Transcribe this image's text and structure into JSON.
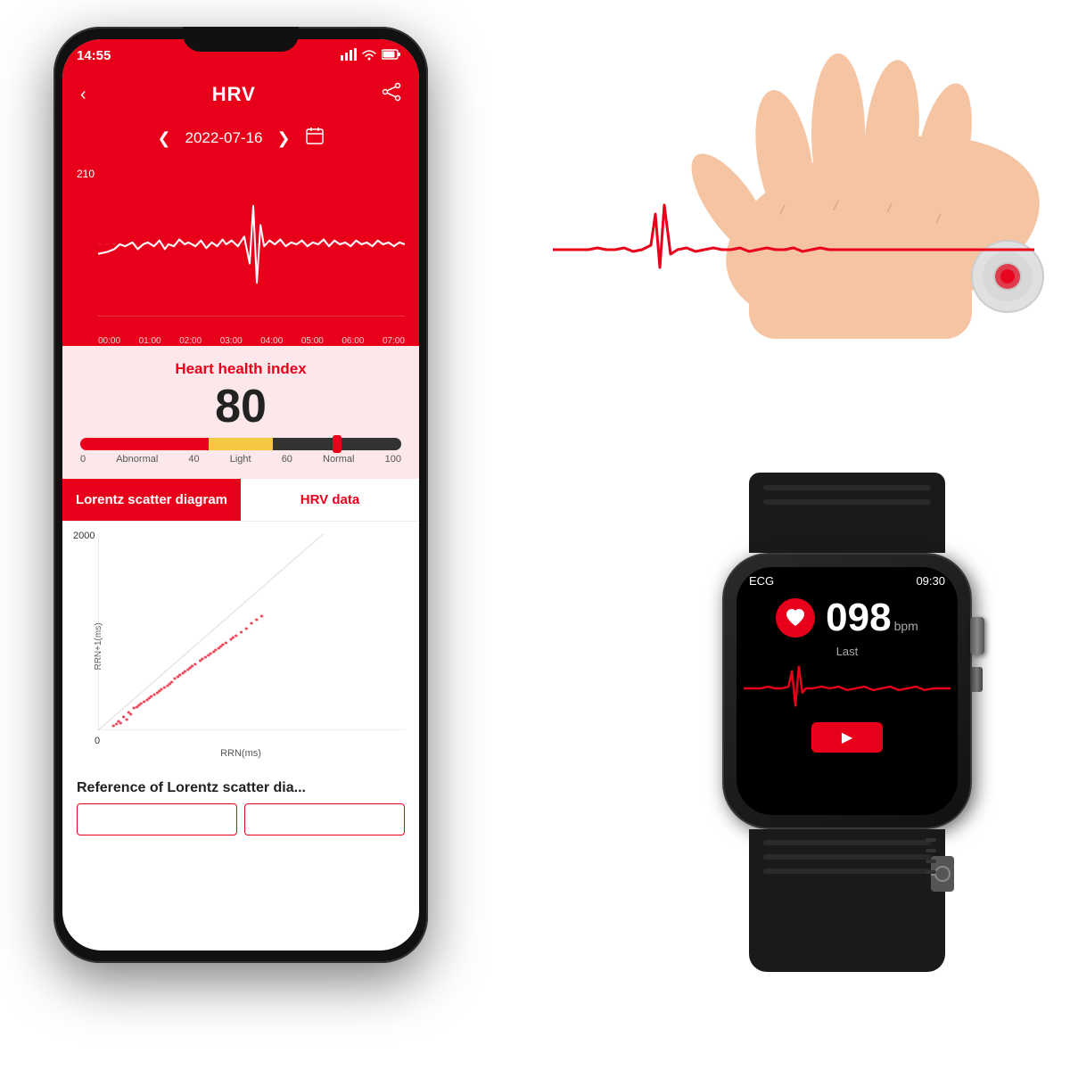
{
  "status_bar": {
    "time": "14:55",
    "signal_icon": "📶",
    "wifi_icon": "WiFi",
    "battery_icon": "🔋"
  },
  "nav": {
    "back_label": "‹",
    "title": "HRV",
    "share_label": "⎙"
  },
  "date_picker": {
    "prev_label": "❮",
    "date": "2022-07-16",
    "next_label": "❯",
    "calendar_label": "📅"
  },
  "chart": {
    "y_max": "210",
    "y_min": "0",
    "x_labels": [
      "00:00",
      "01:00",
      "02:00",
      "03:00",
      "04:00",
      "05:00",
      "06:00",
      "07:00"
    ]
  },
  "health_index": {
    "title": "Heart health index",
    "value": "80",
    "bar_labels": [
      "0",
      "Abnormal",
      "40",
      "Light",
      "60",
      "Normal",
      "100"
    ],
    "marker_position_pct": 80
  },
  "tabs": {
    "active": "Lorentz scatter diagram",
    "inactive": "HRV data"
  },
  "scatter": {
    "y_max": "2000",
    "y_zero": "0",
    "y_axis_label": "RRN+1(ms)",
    "x_axis_label": "RRN(ms)"
  },
  "reference": {
    "title": "Reference of Lorentz scatter dia..."
  },
  "watch": {
    "label_ecg": "ECG",
    "time": "09:30",
    "bpm": "098",
    "bpm_unit": "bpm",
    "last_label": "Last",
    "play_icon": "▶"
  }
}
